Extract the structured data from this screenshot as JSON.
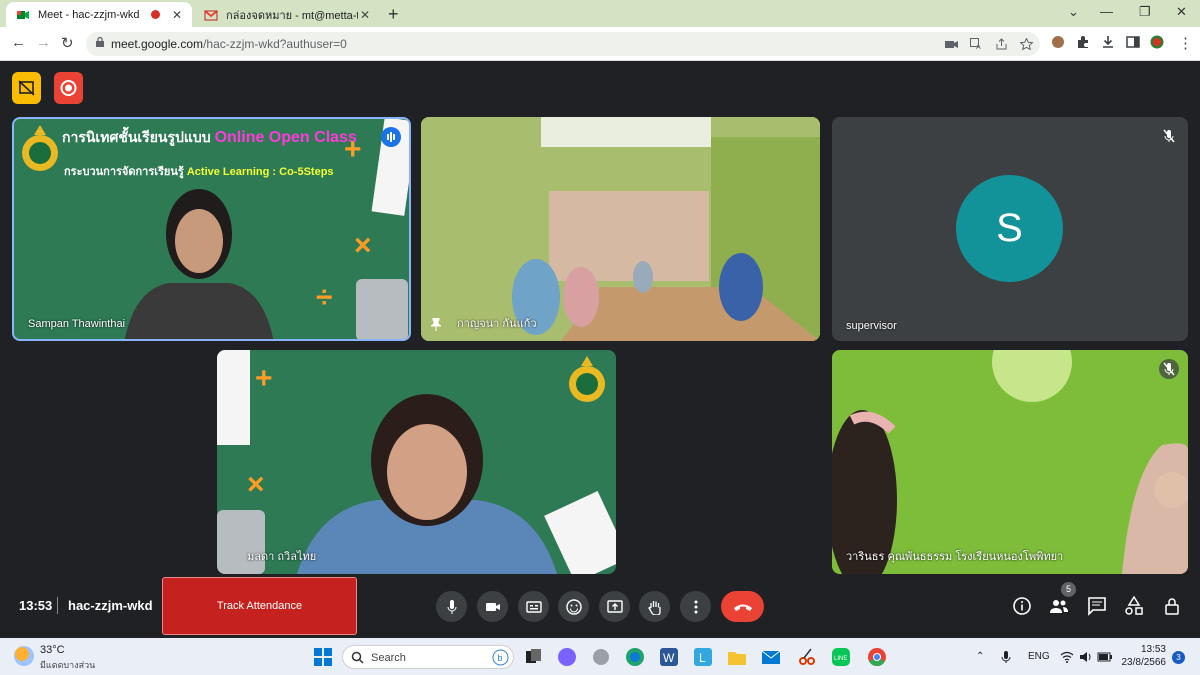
{
  "browser": {
    "tabs": [
      {
        "title": "Meet - hac-zzjm-wkd",
        "active": true
      },
      {
        "title": "กล่องจดหมาย - mt@metta-tt.info -",
        "active": false
      }
    ],
    "url_host": "meet.google.com",
    "url_path": "/hac-zzjm-wkd?authuser=0"
  },
  "meeting": {
    "time": "13:53",
    "code": "hac-zzjm-wkd",
    "attendance_button": "Track Attendance",
    "participants_count": "5"
  },
  "tiles": [
    {
      "name": "Sampan Thawinthai",
      "slide_title_a": "การนิเทศชั้นเรียนรูปแบบ ",
      "slide_title_b": "Online Open Class",
      "slide_sub_a": "กระบวนการจัดการเรียนรู้ ",
      "slide_sub_b": "Active Learning : Co-5Steps"
    },
    {
      "name": "กาญจนา กันแก้ว"
    },
    {
      "name": "supervisor",
      "avatar_letter": "S"
    },
    {
      "name": "มลดา ถวิลไทย"
    },
    {
      "name": "วารินธร คุณพันธธรรม โรงเรียนหนองโพพิทยา"
    }
  ],
  "taskbar": {
    "temperature": "33°C",
    "condition": "มีแดดบางส่วน",
    "search_label": "Search",
    "language": "ENG",
    "time": "13:53",
    "date": "23/8/2566",
    "notifications": "3"
  },
  "colors": {
    "accent_red": "#ea4335",
    "meet_bg": "#202124",
    "avatar": "#12939a"
  }
}
